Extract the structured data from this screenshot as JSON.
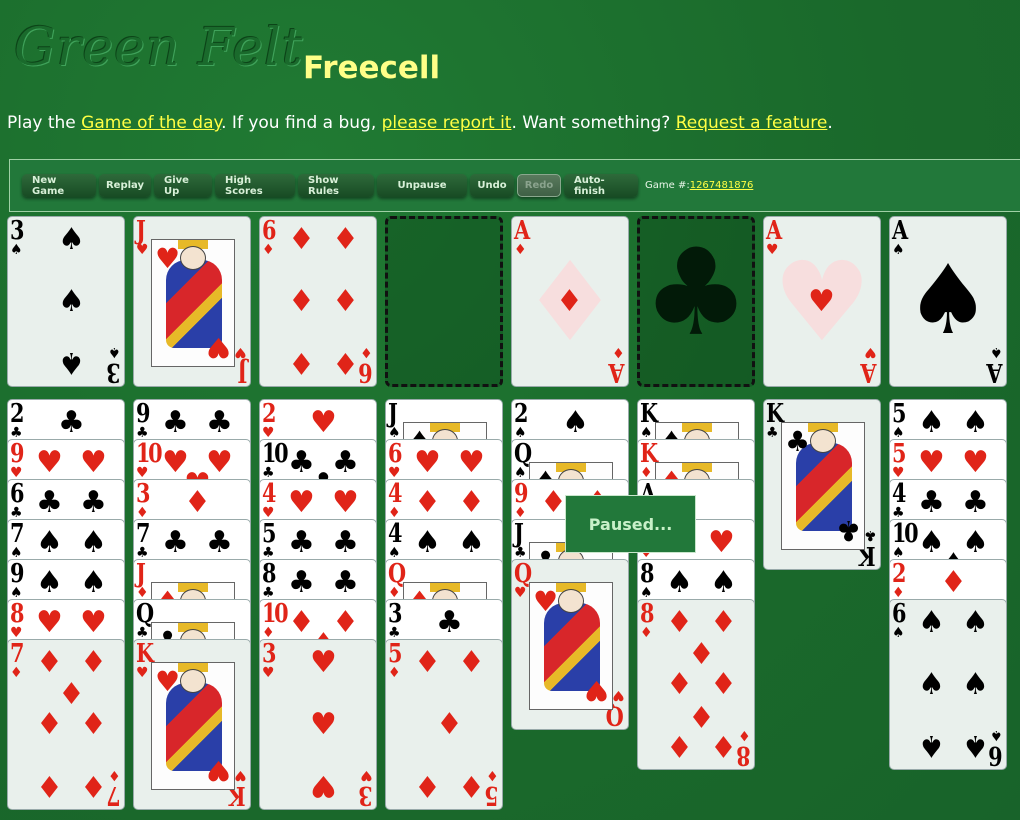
{
  "header": {
    "logo_text": "Green Felt",
    "title": "Freecell"
  },
  "intro": {
    "prefix": "Play the ",
    "game_of_day_link": "Game of the day",
    "mid1": ". If you find a bug, ",
    "report_link": "please report it",
    "mid2": ". Want something? ",
    "feature_link": "Request a feature",
    "suffix": "."
  },
  "toolbar": {
    "buttons": [
      {
        "label": "New Game",
        "enabled": true
      },
      {
        "label": "Replay",
        "enabled": true
      },
      {
        "label": "Give Up",
        "enabled": true
      },
      {
        "label": "High Scores",
        "enabled": true
      },
      {
        "label": "Show Rules",
        "enabled": true
      },
      {
        "label": "Unpause",
        "enabled": true
      },
      {
        "label": "Undo",
        "enabled": true
      },
      {
        "label": "Redo",
        "enabled": false
      },
      {
        "label": "Auto-finish",
        "enabled": true
      }
    ],
    "game_number_label": "Game #:",
    "game_number": "1267481876"
  },
  "free_cells": [
    {
      "rank": "3",
      "suit": "♠",
      "color": "black"
    },
    {
      "rank": "J",
      "suit": "♥",
      "color": "red"
    },
    {
      "rank": "6",
      "suit": "♦",
      "color": "red"
    },
    null
  ],
  "foundations": [
    {
      "rank": "A",
      "suit": "♦",
      "color": "red"
    },
    {
      "rank": "",
      "suit": "♣",
      "color": "black",
      "empty": true
    },
    {
      "rank": "A",
      "suit": "♥",
      "color": "red"
    },
    {
      "rank": "A",
      "suit": "♠",
      "color": "black"
    }
  ],
  "tableau": [
    [
      {
        "rank": "2",
        "suit": "♣"
      },
      {
        "rank": "9",
        "suit": "♥"
      },
      {
        "rank": "6",
        "suit": "♣"
      },
      {
        "rank": "7",
        "suit": "♠"
      },
      {
        "rank": "9",
        "suit": "♠"
      },
      {
        "rank": "8",
        "suit": "♥"
      },
      {
        "rank": "7",
        "suit": "♦"
      }
    ],
    [
      {
        "rank": "9",
        "suit": "♣"
      },
      {
        "rank": "10",
        "suit": "♥"
      },
      {
        "rank": "3",
        "suit": "♦"
      },
      {
        "rank": "7",
        "suit": "♣"
      },
      {
        "rank": "J",
        "suit": "♦"
      },
      {
        "rank": "Q",
        "suit": "♣"
      },
      {
        "rank": "K",
        "suit": "♥"
      }
    ],
    [
      {
        "rank": "2",
        "suit": "♥"
      },
      {
        "rank": "10",
        "suit": "♣"
      },
      {
        "rank": "4",
        "suit": "♥"
      },
      {
        "rank": "5",
        "suit": "♣"
      },
      {
        "rank": "8",
        "suit": "♣"
      },
      {
        "rank": "10",
        "suit": "♦"
      },
      {
        "rank": "3",
        "suit": "♥"
      }
    ],
    [
      {
        "rank": "J",
        "suit": "♠"
      },
      {
        "rank": "6",
        "suit": "♥"
      },
      {
        "rank": "4",
        "suit": "♦"
      },
      {
        "rank": "4",
        "suit": "♠"
      },
      {
        "rank": "Q",
        "suit": "♦"
      },
      {
        "rank": "3",
        "suit": "♣"
      },
      {
        "rank": "5",
        "suit": "♦"
      }
    ],
    [
      {
        "rank": "2",
        "suit": "♠"
      },
      {
        "rank": "Q",
        "suit": "♠"
      },
      {
        "rank": "9",
        "suit": "♦"
      },
      {
        "rank": "J",
        "suit": "♣"
      },
      {
        "rank": "Q",
        "suit": "♥"
      }
    ],
    [
      {
        "rank": "K",
        "suit": "♠"
      },
      {
        "rank": "K",
        "suit": "♦"
      },
      {
        "rank": "A",
        "suit": "♣"
      },
      {
        "rank": "",
        "suit": "♥"
      },
      {
        "rank": "8",
        "suit": "♠"
      },
      {
        "rank": "8",
        "suit": "♦"
      }
    ],
    [
      {
        "rank": "K",
        "suit": "♣"
      }
    ],
    [
      {
        "rank": "5",
        "suit": "♠"
      },
      {
        "rank": "5",
        "suit": "♥"
      },
      {
        "rank": "4",
        "suit": "♣"
      },
      {
        "rank": "10",
        "suit": "♠"
      },
      {
        "rank": "2",
        "suit": "♦"
      },
      {
        "rank": "6",
        "suit": "♠"
      }
    ]
  ],
  "overlay": {
    "paused_text": "Paused..."
  },
  "colors": {
    "felt": "#1d6e2e",
    "link": "#ffff44",
    "title": "#ffff88",
    "red_suit": "#e02418"
  }
}
